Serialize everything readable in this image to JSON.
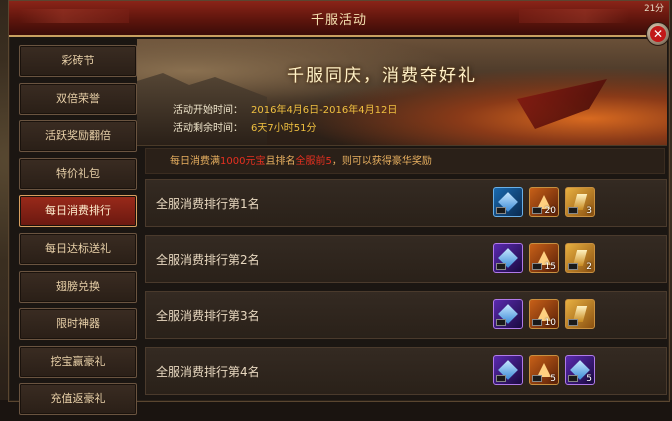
{
  "clock": "21分",
  "window": {
    "title": "千服活动"
  },
  "sidebar": {
    "items": [
      {
        "label": "彩砖节"
      },
      {
        "label": "双倍荣誉"
      },
      {
        "label": "活跃奖励翻倍"
      },
      {
        "label": "特价礼包"
      },
      {
        "label": "每日消费排行",
        "active": true
      },
      {
        "label": "每日达标送礼"
      },
      {
        "label": "翅膀兑换"
      },
      {
        "label": "限时神器"
      },
      {
        "label": "挖宝赢豪礼"
      },
      {
        "label": "充值返豪礼"
      }
    ]
  },
  "banner": {
    "title": "千服同庆，消费夺好礼",
    "start_label": "活动开始时间：",
    "start_value": "2016年4月6日-2016年4月12日",
    "remain_label": "活动剩余时间：",
    "remain_value": "6天7小时51分"
  },
  "notice": {
    "p1": "每日消费满",
    "h1": "1000元宝",
    "p2": "且排名",
    "h2": "全服前5",
    "p3": "，则可以获得豪华奖励"
  },
  "ranks": [
    {
      "title": "全服消费排行第1名",
      "rewards": [
        {
          "kind": "blue-gem-icon",
          "color": "blue",
          "count": ""
        },
        {
          "kind": "orange-crystal-icon",
          "color": "orange",
          "count": "20"
        },
        {
          "kind": "gold-feather-icon",
          "color": "gold",
          "count": "3"
        }
      ]
    },
    {
      "title": "全服消费排行第2名",
      "rewards": [
        {
          "kind": "purple-gem-icon",
          "color": "purple",
          "count": ""
        },
        {
          "kind": "orange-crystal-icon",
          "color": "orange",
          "count": "15"
        },
        {
          "kind": "gold-feather-icon",
          "color": "gold",
          "count": "2"
        }
      ]
    },
    {
      "title": "全服消费排行第3名",
      "rewards": [
        {
          "kind": "purple-gem-icon",
          "color": "purple",
          "count": ""
        },
        {
          "kind": "orange-crystal-icon",
          "color": "orange",
          "count": "10"
        },
        {
          "kind": "gold-feather-icon",
          "color": "gold",
          "count": ""
        }
      ]
    },
    {
      "title": "全服消费排行第4名",
      "rewards": [
        {
          "kind": "purple-gem-icon",
          "color": "purple",
          "count": ""
        },
        {
          "kind": "orange-crystal-icon",
          "color": "orange",
          "count": "5"
        },
        {
          "kind": "purple-feather-icon",
          "color": "purple",
          "count": "5"
        }
      ]
    }
  ]
}
